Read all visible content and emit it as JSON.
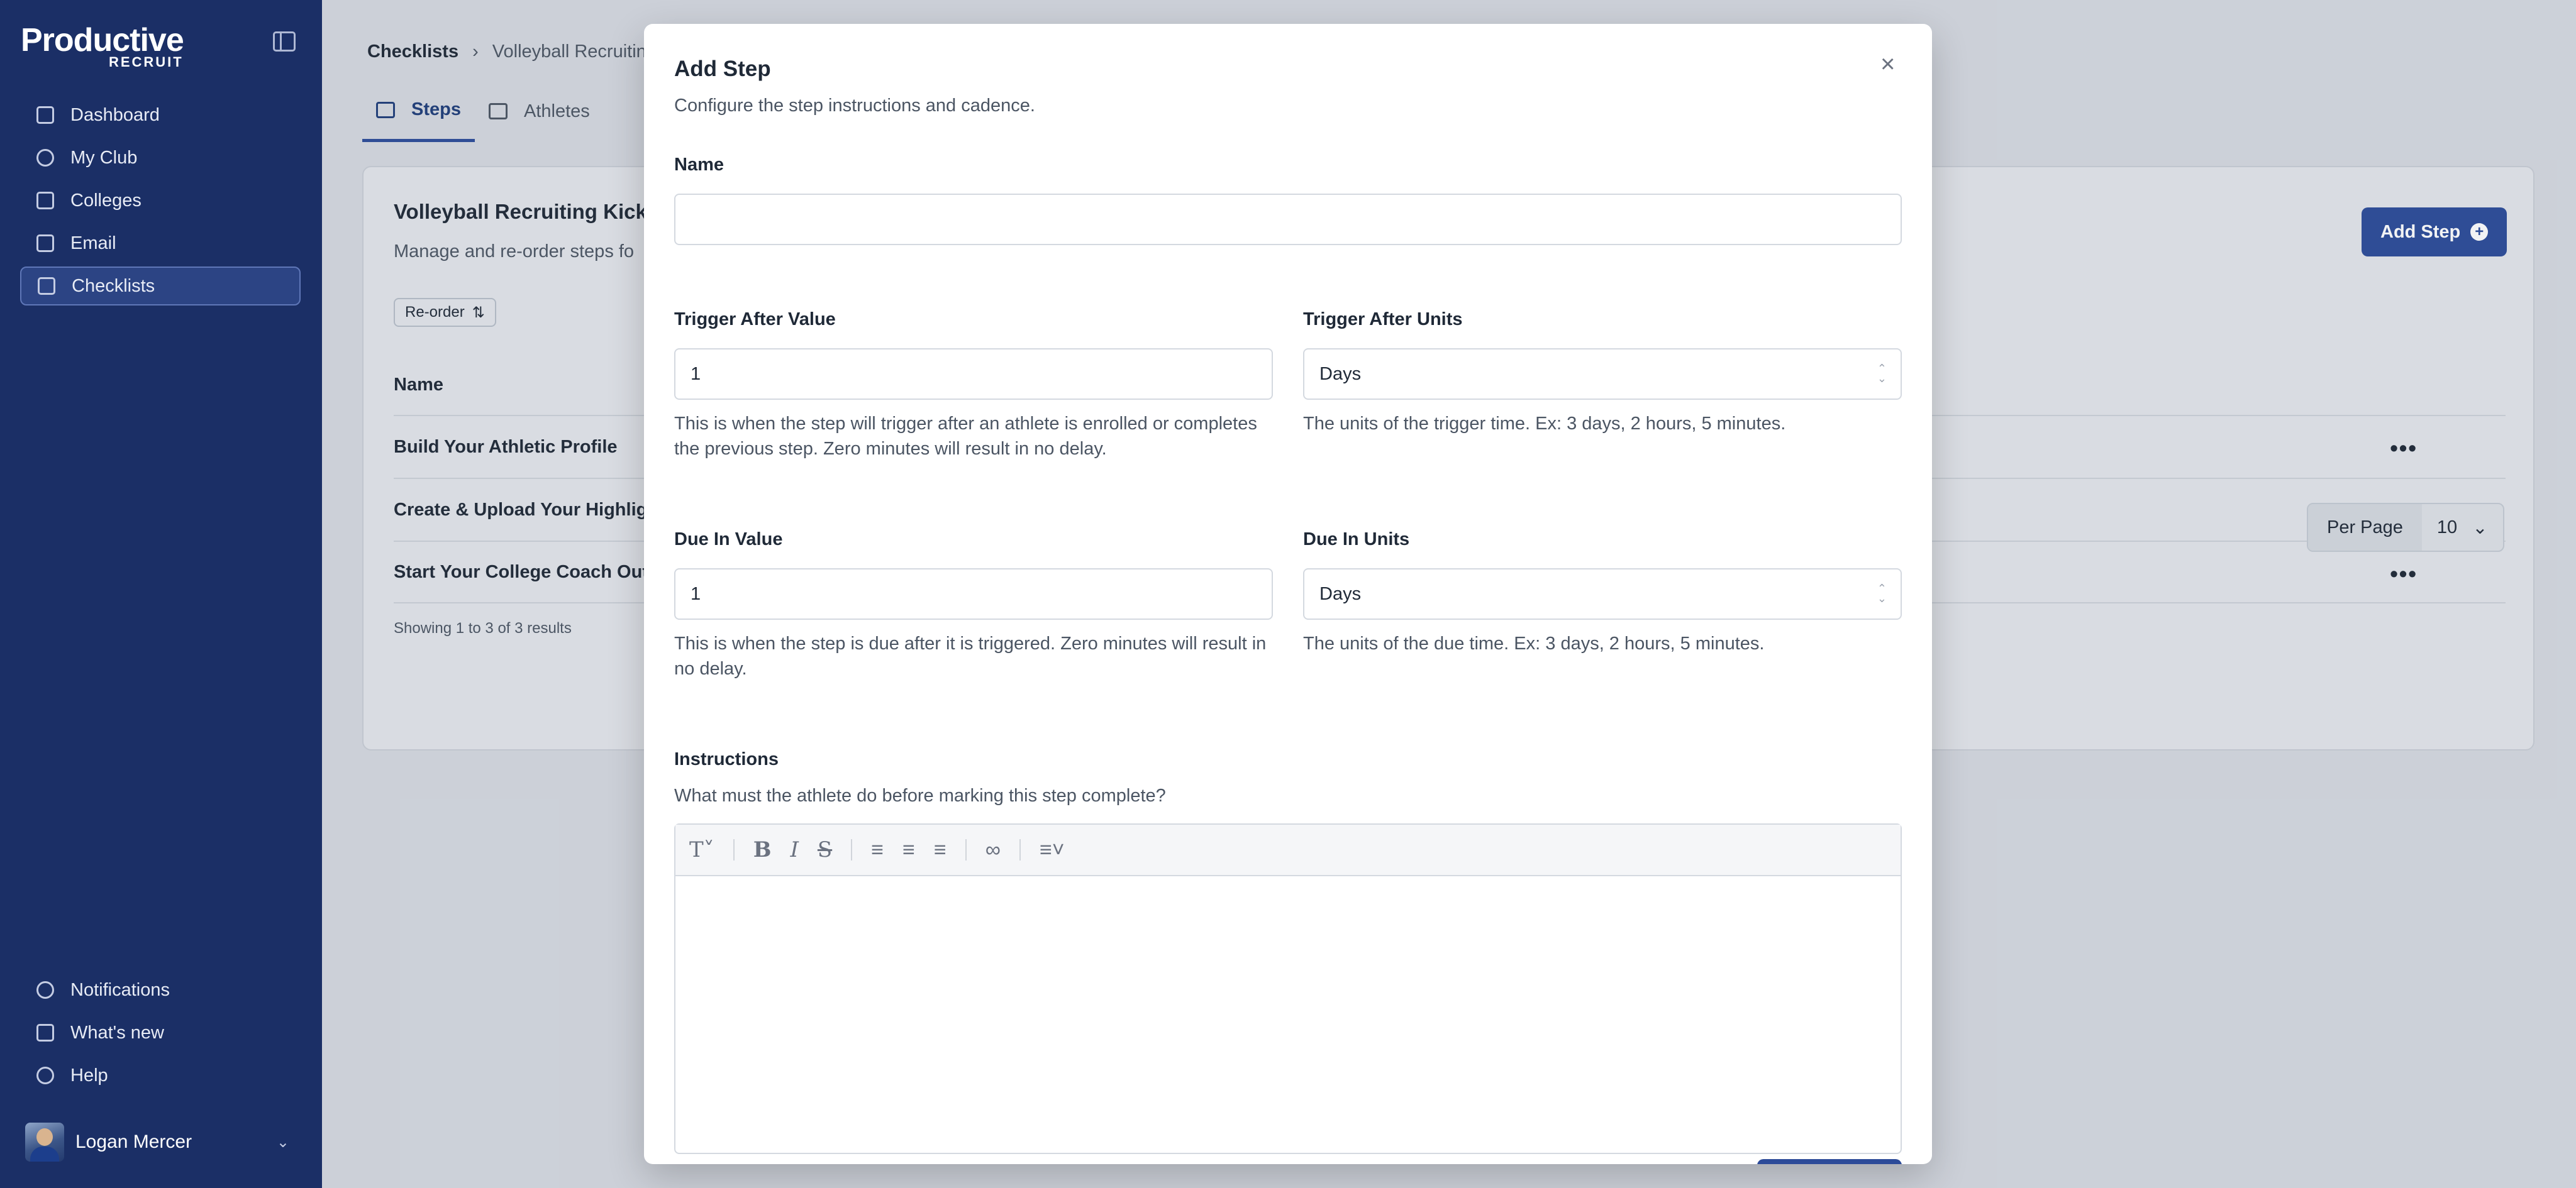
{
  "app": {
    "logo_top": "Productive",
    "logo_bottom": "RECRUIT"
  },
  "sidebar": {
    "items": [
      {
        "label": "Dashboard",
        "icon": "home-icon"
      },
      {
        "label": "My Club",
        "icon": "shield-icon"
      },
      {
        "label": "Colleges",
        "icon": "building-icon"
      },
      {
        "label": "Email",
        "icon": "mail-icon"
      },
      {
        "label": "Checklists",
        "icon": "list-icon",
        "active": true
      }
    ],
    "bottom_items": [
      {
        "label": "Notifications",
        "icon": "bell-icon"
      },
      {
        "label": "What's new",
        "icon": "gift-icon"
      },
      {
        "label": "Help",
        "icon": "help-icon"
      }
    ],
    "user": {
      "name": "Logan Mercer"
    }
  },
  "breadcrumb": {
    "first": "Checklists",
    "second": "Volleyball Recruitin"
  },
  "tabs": {
    "steps": "Steps",
    "athletes": "Athletes"
  },
  "card": {
    "title": "Volleyball Recruiting Kicks",
    "subtitle": "Manage and re-order steps fo",
    "reorder_label": "Re-order",
    "add_step_label": "Add Step",
    "column_name": "Name",
    "rows": [
      "Build Your Athletic Profile",
      "Create & Upload Your Highligh",
      "Start Your College Coach Outr"
    ],
    "results": "Showing 1 to 3 of 3 results",
    "per_page_label": "Per Page",
    "per_page_value": "10"
  },
  "modal": {
    "title": "Add Step",
    "description": "Configure the step instructions and cadence.",
    "name_label": "Name",
    "name_value": "",
    "trigger_value_label": "Trigger After Value",
    "trigger_value": "1",
    "trigger_value_help": "This is when the step will trigger after an athlete is enrolled or completes the previous step. Zero minutes will result in no delay.",
    "trigger_units_label": "Trigger After Units",
    "trigger_units_value": "Days",
    "trigger_units_help": "The units of the trigger time. Ex: 3 days, 2 hours, 5 minutes.",
    "due_value_label": "Due In Value",
    "due_value": "1",
    "due_value_help": "This is when the step is due after it is triggered. Zero minutes will result in no delay.",
    "due_units_label": "Due In Units",
    "due_units_value": "Days",
    "due_units_help": "The units of the due time. Ex: 3 days, 2 hours, 5 minutes.",
    "instructions_label": "Instructions",
    "instructions_help": "What must the athlete do before marking this step complete?"
  },
  "colors": {
    "sidebar": "#1b2f66",
    "accent": "#2c4b99"
  }
}
